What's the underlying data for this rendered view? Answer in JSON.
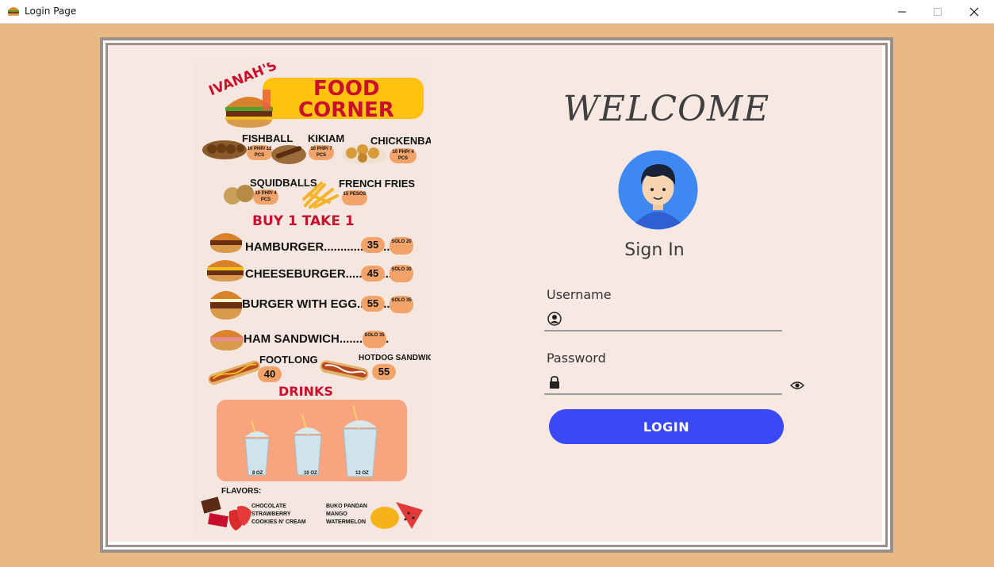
{
  "window": {
    "title": "Login Page"
  },
  "menu": {
    "brand": "IVANAH'S",
    "title_line1": "FOOD",
    "title_line2": "CORNER",
    "snacks": [
      {
        "name": "FISHBALL",
        "price": "10 PHP/ 12 PCS"
      },
      {
        "name": "KIKIAM",
        "price": "10 PHP/ 7 PCS"
      },
      {
        "name": "CHICKENBALL",
        "price": "10 PHP/ 4 PCS"
      },
      {
        "name": "SQUIDBALLS",
        "price": "10 PHP/ 4 PCS"
      },
      {
        "name": "FRENCH FRIES",
        "price": "15 PESOS"
      }
    ],
    "promo": "BUY 1 TAKE 1",
    "burgers": [
      {
        "name": "HAMBURGER.....................",
        "price": "35",
        "solo": "SOLO 20"
      },
      {
        "name": "CHEESEBURGER................",
        "price": "45",
        "solo": "SOLO 30"
      },
      {
        "name": "BURGER WITH EGG..........",
        "price": "55",
        "solo": "SOLO 35"
      },
      {
        "name": "HAM SANDWICH...............",
        "solo": "SOLO 35"
      }
    ],
    "footlong": {
      "name": "FOOTLONG",
      "price": "40"
    },
    "hotdog": {
      "name": "HOTDOG SANDWICH",
      "price": "55"
    },
    "drinks_title": "DRINKS",
    "drink_sizes": [
      "8 OZ",
      "10 OZ",
      "12 OZ"
    ],
    "flavors_title": "FLAVORS:",
    "flavors_left": [
      "CHOCOLATE",
      "STRAWBERRY",
      "COOKIES N' CREAM"
    ],
    "flavors_right": [
      "BUKO PANDAN",
      "MANGO",
      "WATERMELON"
    ]
  },
  "login": {
    "welcome": "WELCOME",
    "signin": "Sign In",
    "username_label": "Username",
    "username_value": "",
    "password_label": "Password",
    "password_value": "",
    "button": "LOGIN"
  },
  "colors": {
    "background": "#e8b985",
    "panel": "#f8e8e2",
    "button": "#3a48f6",
    "title_accent": "#ffc20e",
    "brand_red": "#c8102e"
  }
}
